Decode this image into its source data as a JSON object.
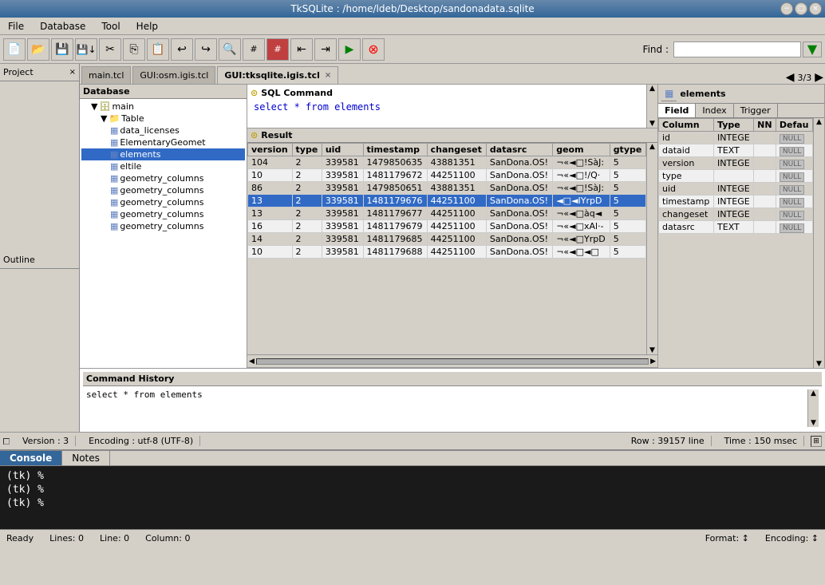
{
  "titlebar": {
    "title": "TkSQLite : /home/ldeb/Desktop/sandonadata.sqlite"
  },
  "menubar": {
    "items": [
      "File",
      "Database",
      "Tool",
      "Help"
    ]
  },
  "toolbar": {
    "find_label": "Find :",
    "find_placeholder": ""
  },
  "tabs": {
    "items": [
      {
        "label": "main.tcl",
        "active": false,
        "closable": false
      },
      {
        "label": "GUI:osm.igis.tcl",
        "active": false,
        "closable": false
      },
      {
        "label": "GUI:tksqlite.igis.tcl",
        "active": true,
        "closable": true
      }
    ],
    "nav": "3/3"
  },
  "database": {
    "header": "Database",
    "tree": [
      {
        "label": "main",
        "level": 1,
        "type": "db",
        "expanded": true
      },
      {
        "label": "Table",
        "level": 2,
        "type": "folder",
        "expanded": true
      },
      {
        "label": "data_licenses",
        "level": 3,
        "type": "table"
      },
      {
        "label": "ElementaryGeomet",
        "level": 3,
        "type": "table"
      },
      {
        "label": "elements",
        "level": 3,
        "type": "table",
        "selected": true
      },
      {
        "label": "eltile",
        "level": 3,
        "type": "table"
      },
      {
        "label": "geometry_columns",
        "level": 3,
        "type": "table"
      },
      {
        "label": "geometry_columns",
        "level": 3,
        "type": "table"
      },
      {
        "label": "geometry_columns",
        "level": 3,
        "type": "table"
      },
      {
        "label": "geometry_columns",
        "level": 3,
        "type": "table"
      },
      {
        "label": "geometry_columns",
        "level": 3,
        "type": "table"
      }
    ]
  },
  "elements_panel": {
    "header": "elements",
    "tabs": [
      "Field",
      "Index",
      "Trigger"
    ],
    "active_tab": "Field",
    "columns": [
      "Column",
      "Type",
      "NN",
      "Defau"
    ],
    "rows": [
      {
        "column": "id",
        "type": "INTEGE",
        "nn": "",
        "default": "NULL"
      },
      {
        "column": "dataid",
        "type": "TEXT",
        "nn": "",
        "default": "NULL"
      },
      {
        "column": "version",
        "type": "INTEGE",
        "nn": "",
        "default": "NULL"
      },
      {
        "column": "type",
        "type": "",
        "nn": "",
        "default": "NULL"
      },
      {
        "column": "uid",
        "type": "INTEGE",
        "nn": "",
        "default": "NULL"
      },
      {
        "column": "timestamp",
        "type": "INTEGE",
        "nn": "",
        "default": "NULL"
      },
      {
        "column": "changeset",
        "type": "INTEGE",
        "nn": "",
        "default": "NULL"
      },
      {
        "column": "datasrc",
        "type": "TEXT",
        "nn": "",
        "default": "NULL"
      }
    ]
  },
  "sql_command": {
    "header": "SQL Command",
    "text": "select * from elements"
  },
  "result": {
    "header": "Result",
    "columns": [
      "version",
      "type",
      "uid",
      "timestamp",
      "changeset",
      "datasrc",
      "geom",
      "gtype"
    ],
    "rows": [
      {
        "version": "104",
        "type": "2",
        "uid": "339581",
        "timestamp": "1479850635",
        "changeset": "43881351",
        "datasrc": "SanDona.OS!",
        "geom": "¬«◄□!SàJ:",
        "gtype": "5"
      },
      {
        "version": "10",
        "type": "2",
        "uid": "339581",
        "timestamp": "1481179672",
        "changeset": "44251100",
        "datasrc": "SanDona.OS!",
        "geom": "¬«◄□!/Q·",
        "gtype": "5"
      },
      {
        "version": "86",
        "type": "2",
        "uid": "339581",
        "timestamp": "1479850651",
        "changeset": "43881351",
        "datasrc": "SanDona.OS!",
        "geom": "¬«◄□!SàJ:",
        "gtype": "5"
      },
      {
        "version": "13",
        "type": "2",
        "uid": "339581",
        "timestamp": "1481179676",
        "changeset": "44251100",
        "datasrc": "SanDona.OS!",
        "geom": "◄□◄IYrpD",
        "gtype": "5",
        "selected": true
      },
      {
        "version": "13",
        "type": "2",
        "uid": "339581",
        "timestamp": "1481179677",
        "changeset": "44251100",
        "datasrc": "SanDona.OS!",
        "geom": "¬«◄□àq◄",
        "gtype": "5"
      },
      {
        "version": "16",
        "type": "2",
        "uid": "339581",
        "timestamp": "1481179679",
        "changeset": "44251100",
        "datasrc": "SanDona.OS!",
        "geom": "¬«◄□xAl·-",
        "gtype": "5"
      },
      {
        "version": "14",
        "type": "2",
        "uid": "339581",
        "timestamp": "1481179685",
        "changeset": "44251100",
        "datasrc": "SanDona.OS!",
        "geom": "¬«◄□YrpD",
        "gtype": "5"
      },
      {
        "version": "10",
        "type": "2",
        "uid": "339581",
        "timestamp": "1481179688",
        "changeset": "44251100",
        "datasrc": "SanDona.OS!",
        "geom": "¬«◄□◄□",
        "gtype": "5"
      }
    ]
  },
  "command_history": {
    "header": "Command History",
    "text": "select * from elements"
  },
  "statusbar": {
    "version": "Version : 3",
    "encoding": "Encoding : utf-8 (UTF-8)",
    "row": "Row : 39157 line",
    "time": "Time : 150 msec"
  },
  "panels": {
    "project": "Project",
    "outline": "Outline"
  },
  "console": {
    "tabs": [
      "Console",
      "Notes"
    ],
    "active_tab": "Console",
    "lines": [
      "(tk) %",
      "(tk) %",
      "(tk) %"
    ]
  },
  "bottom_status": {
    "ready": "Ready",
    "lines": "Lines: 0",
    "line": "Line: 0",
    "column": "Column: 0",
    "format": "Format: ↕",
    "encoding": "Encoding: ↕"
  }
}
